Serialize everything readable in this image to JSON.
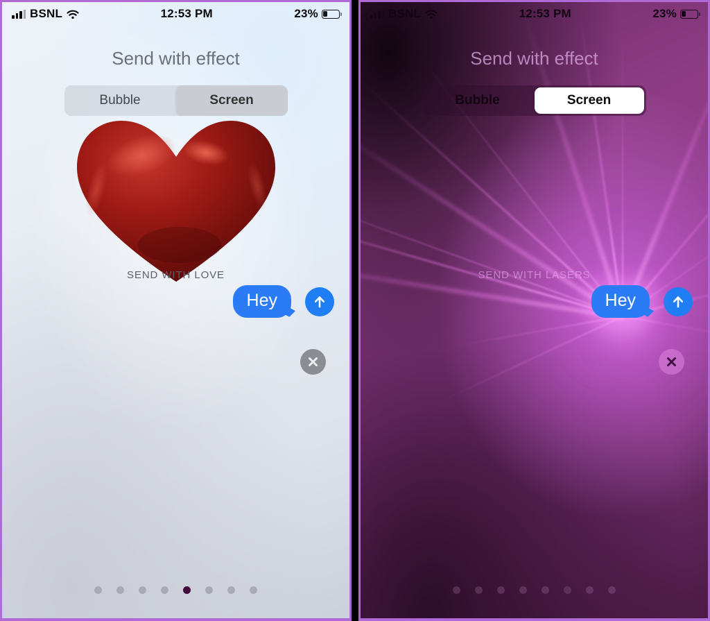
{
  "panels": [
    {
      "id": "bubble-effect-panel",
      "theme": "light",
      "status_bar": {
        "carrier": "BSNL",
        "time": "12:53 PM",
        "battery_percent": "23%",
        "signal_icon": "cellular-bars-icon",
        "wifi_icon": "wifi-icon",
        "battery_icon": "battery-icon"
      },
      "title": "Send with effect",
      "segmented_control": {
        "options": [
          "Bubble",
          "Screen"
        ],
        "selected": "Screen"
      },
      "effect_name": "SEND WITH LOVE",
      "effect_visual": "red-heart-balloon",
      "message": {
        "text": "Hey",
        "bubble_color": "#2b7bf6",
        "send_icon": "arrow-up-icon",
        "close_icon": "close-x-icon"
      },
      "page_dots": {
        "count": 8,
        "active_index": 4
      }
    },
    {
      "id": "screen-effect-panel",
      "theme": "dark",
      "status_bar": {
        "carrier": "BSNL",
        "time": "12:53 PM",
        "battery_percent": "23%",
        "signal_icon": "cellular-bars-icon",
        "wifi_icon": "wifi-icon",
        "battery_icon": "battery-icon"
      },
      "title": "Send with effect",
      "segmented_control": {
        "options": [
          "Bubble",
          "Screen"
        ],
        "selected": "Screen"
      },
      "effect_name": "SEND WITH LASERS",
      "effect_visual": "purple-laser-beams",
      "message": {
        "text": "Hey",
        "bubble_color": "#2b7bf6",
        "send_icon": "arrow-up-icon",
        "close_icon": "close-x-icon"
      },
      "page_dots": {
        "count": 8,
        "active_index": 5
      }
    }
  ],
  "colors": {
    "accent_blue": "#2b7bf6",
    "frame_purple": "#b06ad6",
    "laser_pink": "#ff9bff",
    "heart_red": "#a51b16"
  }
}
